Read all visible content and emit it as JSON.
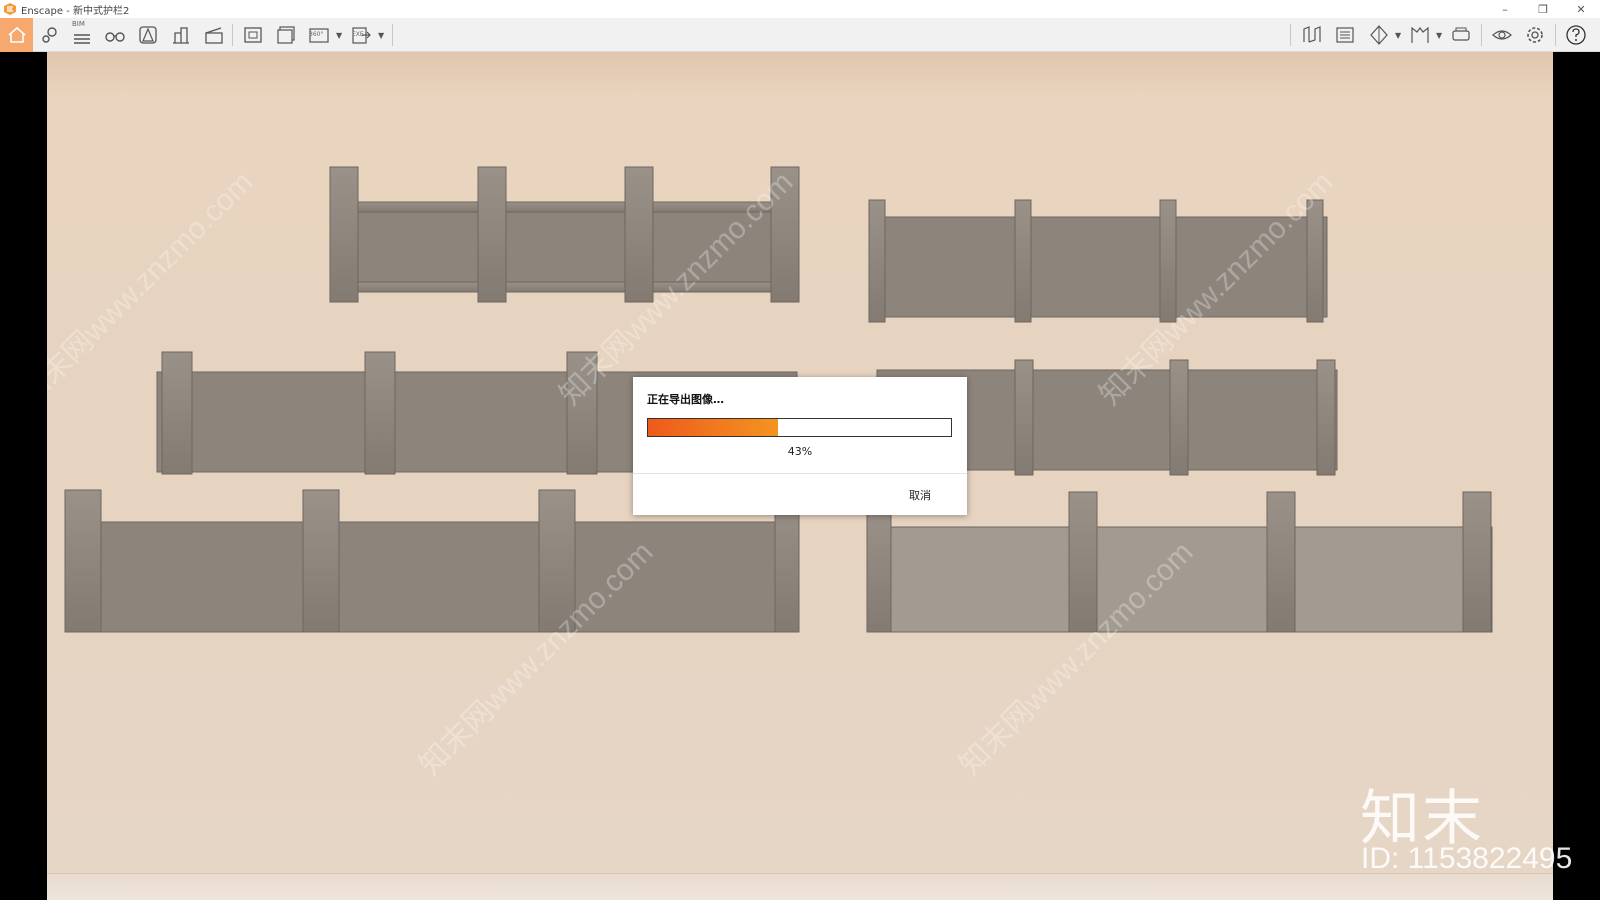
{
  "window": {
    "title": "Enscape - 新中式护栏2",
    "controls": [
      "minimize-icon",
      "restore-icon",
      "close-icon"
    ]
  },
  "toolbar": {
    "bim_label": "BIM",
    "pano_label": "360°",
    "exe_label": "EXE",
    "accent_color": "#f6a86e",
    "left_icons": [
      "home-icon",
      "map-pin-icon",
      "bim-list-icon",
      "binoculars-icon",
      "perspective-icon",
      "building-icon",
      "clapper-icon",
      "screenshot-icon",
      "batch-render-icon",
      "panorama-icon",
      "export-icon"
    ],
    "right_icons": [
      "asset-library-icon",
      "material-editor-icon",
      "visual-settings-icon",
      "views-icon",
      "vr-headset-icon",
      "visibility-icon",
      "settings-icon",
      "help-icon"
    ]
  },
  "viewport": {
    "watermark_brand": "知末",
    "watermark_id": "ID: 1153822495",
    "watermark_url": "知末网www.znzmo.com"
  },
  "dialog": {
    "title": "正在导出图像…",
    "progress_fraction": 0.43,
    "progress_text": "43%",
    "cancel_label": "取消",
    "progress_colors": [
      "#ee5a1c",
      "#f49420"
    ]
  }
}
